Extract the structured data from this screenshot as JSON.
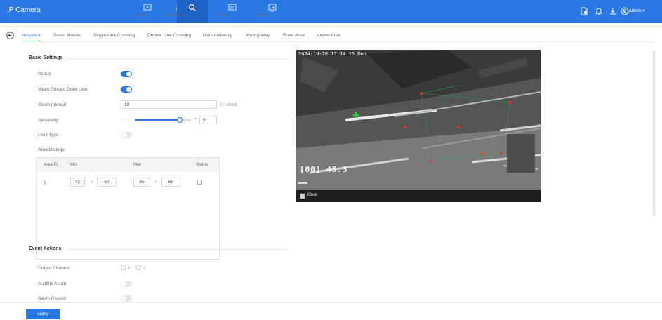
{
  "app": {
    "title": "IP Camera"
  },
  "nav": [
    {
      "label": "Live View",
      "icon": "monitor-icon"
    },
    {
      "label": "Playback",
      "icon": "playback-icon"
    },
    {
      "label": "IVS",
      "icon": "ivs-icon",
      "active": true
    },
    {
      "label": "Thermal",
      "icon": "thermal-icon"
    },
    {
      "label": "Setting",
      "icon": "setting-icon"
    }
  ],
  "header_right": {
    "user": "admin ▾"
  },
  "tabs": [
    "Intrusion",
    "Smart Motion",
    "Single Line Crossing",
    "Double Line Crossing",
    "Multi-Loitering",
    "Wrong-Way",
    "Enter Area",
    "Leave Area"
  ],
  "basic": {
    "title": "Basic Settings",
    "status_label": "Status",
    "status_on": true,
    "draw_line_label": "Video Stream Draw Line",
    "draw_line_on": true,
    "alarm_interval_label": "Alarm Interval",
    "alarm_interval_value": "10",
    "alarm_interval_hint": "(1~1800S",
    "sensitivity_label": "Sensitivity",
    "sensitivity_minus": "—",
    "sensitivity_plus": "+",
    "sensitivity_value": "5",
    "sensitivity_fraction": 0.8,
    "limit_type_label": "Limit Type",
    "limit_type_on": false,
    "area_listings_label": "Area Listings"
  },
  "area_table": {
    "headers": {
      "area_id": "Area ID",
      "min": "Min",
      "max": "Max",
      "status": "Status"
    },
    "rows": [
      {
        "area_id": "1",
        "min_w": "42",
        "min_h": "50",
        "max_w": "85",
        "max_h": "50",
        "sep": "×",
        "status": false
      }
    ]
  },
  "events": {
    "title": "Event Actions",
    "output_channel_label": "Output Channel",
    "output_channels": [
      "1",
      "2"
    ],
    "audible_alarm_label": "Audible Alarm",
    "audible_alarm_on": false,
    "alarm_record_label": "Alarm Record",
    "alarm_record_on": false
  },
  "video": {
    "timestamp": "2024-10-28 17:14:15 Mon",
    "temperature": "[00] 43.3",
    "clear_label": "Clear"
  },
  "apply_label": "Apply",
  "colors": {
    "accent": "#2a78e4",
    "topbar": "#2a78e4"
  }
}
